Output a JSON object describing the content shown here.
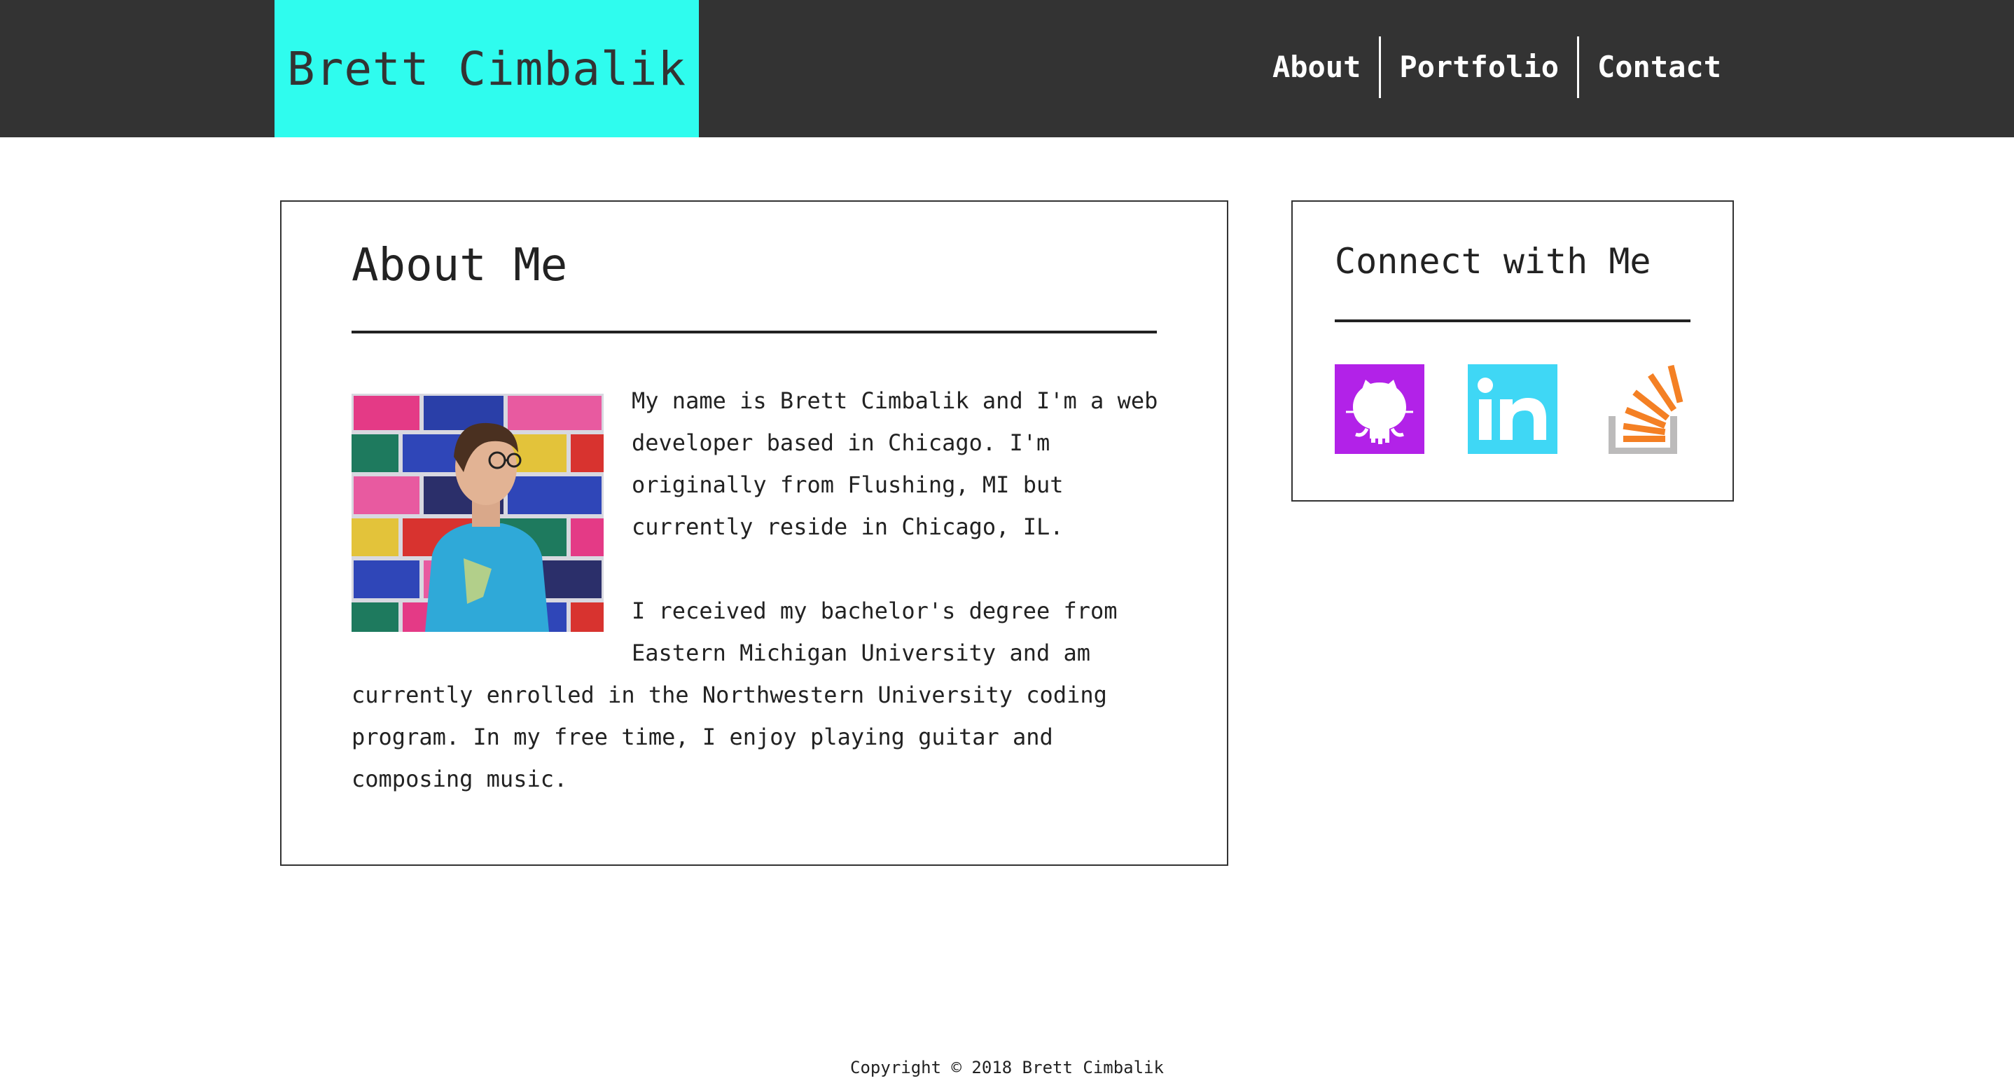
{
  "header": {
    "brand": "Brett Cimbalik",
    "nav": [
      {
        "label": "About"
      },
      {
        "label": "Portfolio"
      },
      {
        "label": "Contact"
      }
    ],
    "background_color": "#333333",
    "brand_color": "#2ffcee"
  },
  "about": {
    "title": "About Me",
    "portrait_alt": "portrait-photo",
    "paragraphs": [
      "My name is Brett Cimbalik and I'm a web developer based in Chicago. I'm originally from Flushing, MI but currently reside in Chicago, IL.",
      "I received my bachelor's degree from Eastern Michigan University and am currently enrolled in the Northwestern University coding program. In my free time, I enjoy playing guitar and composing music."
    ]
  },
  "connect": {
    "title": "Connect with Me",
    "links": [
      {
        "icon": "github-icon",
        "color": "#b222e8"
      },
      {
        "icon": "linkedin-icon",
        "color": "#3fd7f5"
      },
      {
        "icon": "stackoverflow-icon",
        "color": "#f48024"
      }
    ]
  },
  "footer": {
    "copyright": "Copyright © 2018 Brett Cimbalik"
  }
}
